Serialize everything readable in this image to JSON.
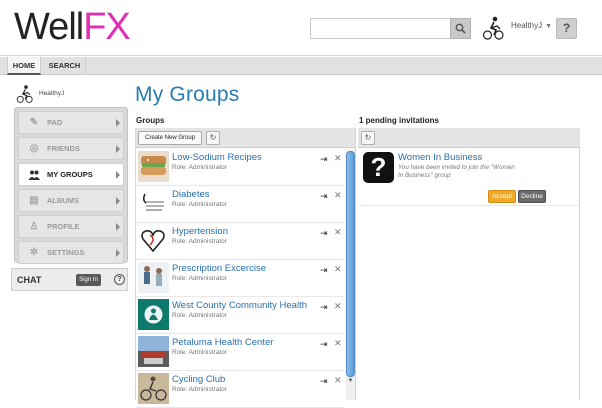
{
  "header": {
    "logo_main": "Well",
    "logo_accent": "FX",
    "search_placeholder": "",
    "username": "HealthyJ",
    "help_label": "?"
  },
  "nav": {
    "tabs": [
      {
        "label": "HOME",
        "active": true
      },
      {
        "label": "SEARCH",
        "active": false
      }
    ]
  },
  "sidebar": {
    "username": "HealthyJ",
    "items": [
      {
        "label": "PAD",
        "icon": "pencil-icon",
        "active": false
      },
      {
        "label": "FRIENDS",
        "icon": "friends-icon",
        "active": false
      },
      {
        "label": "MY GROUPS",
        "icon": "groups-icon",
        "active": true
      },
      {
        "label": "ALBUMS",
        "icon": "albums-icon",
        "active": false
      },
      {
        "label": "PROFILE",
        "icon": "profile-icon",
        "active": false
      },
      {
        "label": "SETTINGS",
        "icon": "gear-icon",
        "active": false
      }
    ],
    "chat": {
      "label": "CHAT",
      "signin_label": "Sign In",
      "help_label": "?"
    }
  },
  "main": {
    "title": "My Groups",
    "groups": {
      "heading": "Groups",
      "create_label": "Create New Group",
      "items": [
        {
          "name": "Low-Sodium Recipes",
          "role": "Role: Administrator"
        },
        {
          "name": "Diabetes",
          "role": "Role: Administrator"
        },
        {
          "name": "Hypertension",
          "role": "Role: Administrator"
        },
        {
          "name": "Prescription Excercise",
          "role": "Role: Administrator"
        },
        {
          "name": "West County Community Health",
          "role": "Role: Administrator"
        },
        {
          "name": "Petaluma Health Center",
          "role": "Role: Administrator"
        },
        {
          "name": "Cycling Club",
          "role": "Role: Administrator"
        }
      ]
    },
    "invitations": {
      "heading": "1 pending invitations",
      "items": [
        {
          "name": "Women In Business",
          "message": "You have been invited to join the \"Women In Business\" group",
          "accept_label": "Accept",
          "decline_label": "Decline"
        }
      ]
    }
  },
  "colors": {
    "accent_blue": "#2a7bb0",
    "logo_pink": "#e02fb4",
    "accept_orange": "#f1a928"
  }
}
